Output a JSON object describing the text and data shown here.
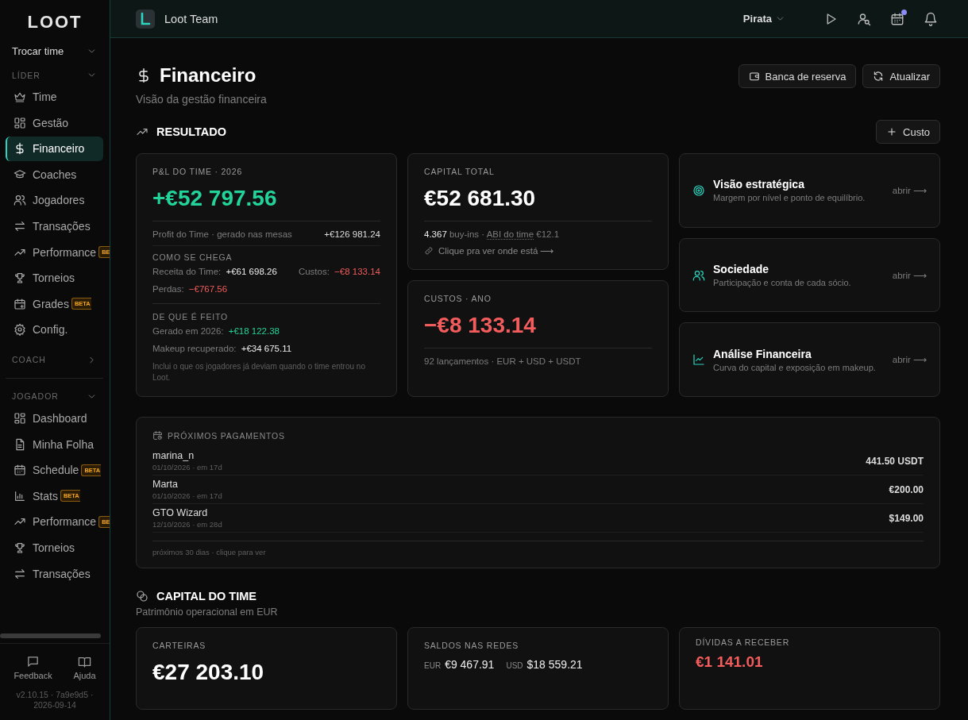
{
  "sidebar": {
    "logo": "LOOT",
    "team_switcher": {
      "label": "Trocar time",
      "expanded": false
    },
    "sections": [
      {
        "title": "LÍDER",
        "expanded": true,
        "items": [
          {
            "label": "Time",
            "selected": false
          },
          {
            "label": "Gestão",
            "selected": false
          },
          {
            "label": "Financeiro",
            "selected": true
          },
          {
            "label": "Coaches",
            "selected": false
          },
          {
            "label": "Jogadores",
            "selected": false
          },
          {
            "label": "Transações",
            "selected": false
          },
          {
            "label": "Performance",
            "selected": false,
            "badge": "BE"
          },
          {
            "label": "Torneios",
            "selected": false
          },
          {
            "label": "Grades",
            "selected": false,
            "badge": "BETA"
          },
          {
            "label": "Config.",
            "selected": false
          }
        ]
      },
      {
        "title": "COACH",
        "expanded": false
      },
      {
        "title": "JOGADOR",
        "expanded": true,
        "items": [
          {
            "label": "Dashboard",
            "selected": false
          },
          {
            "label": "Minha Folha",
            "selected": false
          },
          {
            "label": "Schedule",
            "selected": false,
            "badge": "BETA"
          },
          {
            "label": "Stats",
            "selected": false,
            "badge": "BETA"
          },
          {
            "label": "Performance",
            "selected": false,
            "badge": "BE"
          },
          {
            "label": "Torneios",
            "selected": false
          },
          {
            "label": "Transações",
            "selected": false
          }
        ]
      }
    ],
    "footer_links": [
      {
        "label": "Feedback"
      },
      {
        "label": "Ajuda"
      }
    ],
    "version": "v2.10.15 · 7a9e9d5 · 2026-09-14"
  },
  "topbar": {
    "team": "Loot Team",
    "user": "Pirata",
    "calendar_unread": true
  },
  "page": {
    "title": "Financeiro",
    "subtitle": "Visão da gestão financeira",
    "buttons": [
      {
        "label": "Banca de reserva"
      },
      {
        "label": "Atualizar"
      }
    ]
  },
  "result": {
    "title": "RESULTADO",
    "add_button": "Custo",
    "pl_card": {
      "label": "P&L DO TIME · 2026",
      "value": "+€52 797.56",
      "color": "#22d39a",
      "profit": {
        "label": "Profit do Time · gerado nas mesas",
        "value": "+€126 981.24"
      },
      "groups": [
        {
          "title": "COMO SE CHEGA",
          "rows": [
            {
              "items": [
                {
                  "label": "Receita do Time:",
                  "value": "+€61 698.26",
                  "color": "#eeeeee"
                },
                {
                  "label": "Custos:",
                  "value": "−€8 133.14",
                  "color": "#f25c5c"
                }
              ]
            },
            {
              "items": [
                {
                  "label": "Perdas:",
                  "value": "−€767.56",
                  "color": "#f25c5c"
                }
              ]
            }
          ]
        },
        {
          "title": "DE QUE É FEITO",
          "rows": [
            {
              "items": [
                {
                  "label": "Gerado em 2026:",
                  "value": "+€18 122.38",
                  "color": "#22d39a"
                }
              ]
            },
            {
              "items": [
                {
                  "label": "Makeup recuperado:",
                  "value": "+€34 675.11",
                  "color": "#eeeeee"
                }
              ]
            }
          ],
          "note": "Inclui o que os jogadores já deviam quando o time entrou no Loot."
        }
      ]
    },
    "capital_card": {
      "label": "CAPITAL TOTAL",
      "value": "€52 681.30",
      "color": "#ffffff",
      "buyins_before": "**4.367** buy-ins ·",
      "abi_link": "ABI do time",
      "abi_value": "€12.1",
      "link": "Clique pra ver onde está ⟶"
    },
    "costs_card": {
      "label": "CUSTOS · ANO",
      "value": "−€8 133.14",
      "color": "#f25c5c",
      "footer": "92 lançamentos · EUR + USD + USDT"
    },
    "shortcuts": [
      {
        "title": "Visão estratégica",
        "description": "Margem por nível e ponto de equilíbrio.",
        "action": "abrir ⟶"
      },
      {
        "title": "Sociedade",
        "description": "Participação e conta de cada sócio.",
        "action": "abrir ⟶"
      },
      {
        "title": "Análise Financeira",
        "description": "Curva do capital e exposição em makeup.",
        "action": "abrir ⟶"
      }
    ]
  },
  "payments": {
    "title": "PRÓXIMOS PAGAMENTOS",
    "items": [
      {
        "name": "marina_n",
        "due": "01/10/2026 · em 17d",
        "amount": "441.50 USDT"
      },
      {
        "name": "Marta",
        "due": "01/10/2026 · em 17d",
        "amount": "€200.00"
      },
      {
        "name": "GTO Wizard",
        "due": "12/10/2026 · em 28d",
        "amount": "$149.00"
      }
    ],
    "footer": "próximos 30 dias · clique para ver"
  },
  "capital": {
    "title": "CAPITAL DO TIME",
    "subtitle": "Patrimônio operacional em EUR",
    "wallets": {
      "label": "CARTEIRAS",
      "value": "€27 203.10"
    },
    "networks": {
      "label": "SALDOS NAS REDES",
      "balances": [
        {
          "currency": "EUR",
          "value": "€9 467.91"
        },
        {
          "currency": "USD",
          "value": "$18 559.21"
        }
      ]
    },
    "receivables": {
      "label": "DÍVIDAS A RECEBER",
      "value": "€1 141.01",
      "color": "#f25c5c"
    }
  }
}
